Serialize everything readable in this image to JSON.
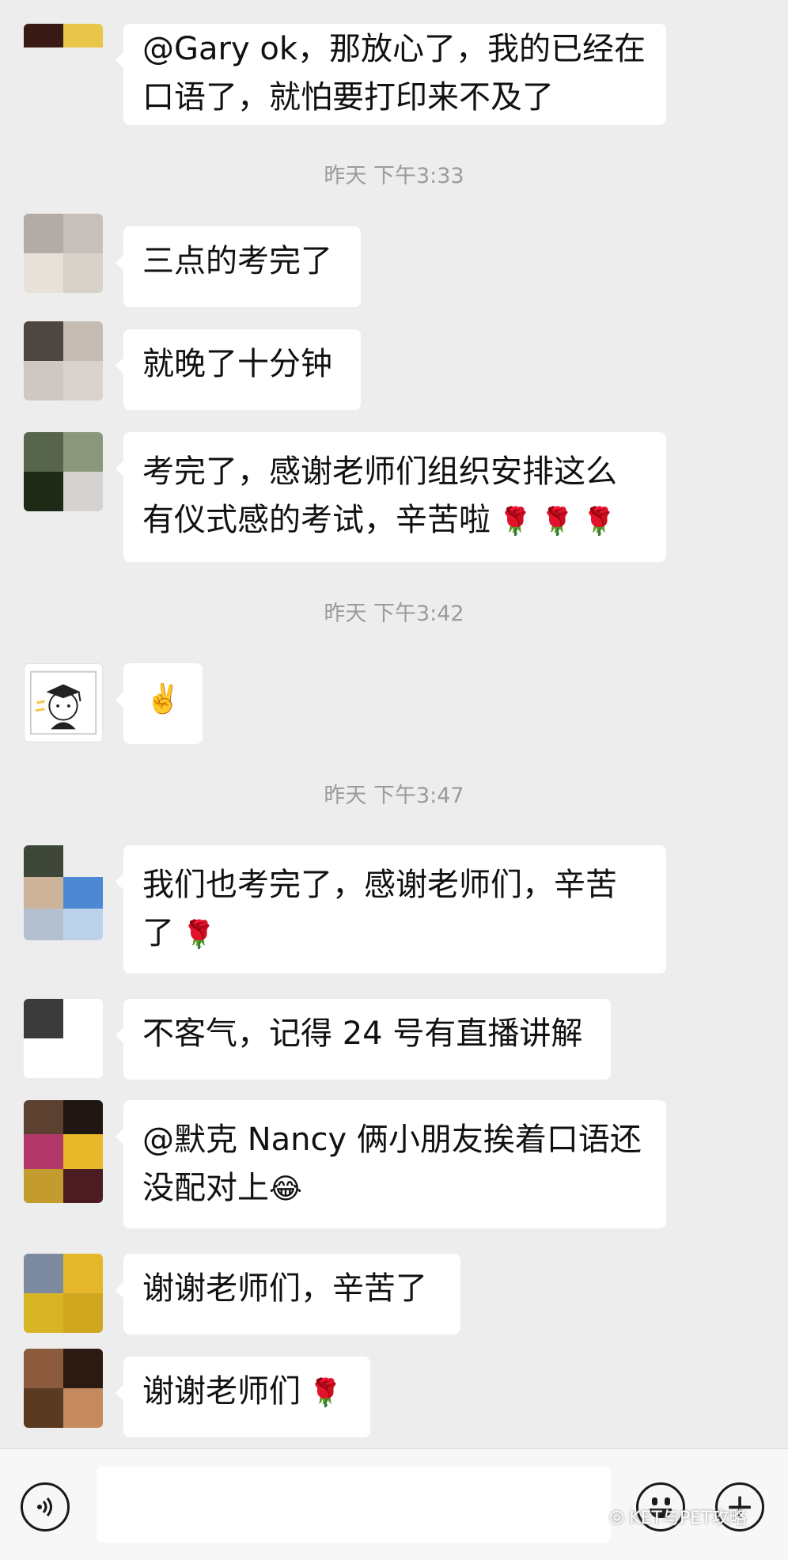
{
  "messages": [
    {
      "text1": "@Gary ok，那放心了，我的已经在",
      "text2": "口语了，就怕要打印来不及了"
    },
    {
      "text1": "三点的考完了"
    },
    {
      "text1": "就晚了十分钟"
    },
    {
      "text1": "考完了，感谢老师们组织安排这么",
      "text2": "有仪式感的考试，辛苦啦",
      "emoji": "🌹 🌹 🌹"
    },
    {
      "emoji": "✌️"
    },
    {
      "text1": "我们也考完了，感谢老师们，辛苦",
      "text2": "了",
      "emoji": "🌹"
    },
    {
      "text1": "不客气，记得 24 号有直播讲解"
    },
    {
      "text1": "@默克 Nancy  俩小朋友挨着口语还",
      "text2": "没配对上",
      "emoji": "😂"
    },
    {
      "text1": "谢谢老师们，辛苦了"
    },
    {
      "text1": "谢谢老师们",
      "emoji": "🌹"
    }
  ],
  "timestamps": [
    "昨天 下午3:33",
    "昨天 下午3:42",
    "昨天 下午3:47"
  ],
  "input_bar": {
    "voice_icon": "voice-icon",
    "emoji_icon": "emoji-icon",
    "plus_icon": "plus-icon"
  },
  "watermark": {
    "text": "KET与PET攻略"
  },
  "colors": {
    "background": "#ededed",
    "bubble": "#ffffff",
    "timestamp": "#9b9b9b",
    "rose": "#c8102e"
  }
}
